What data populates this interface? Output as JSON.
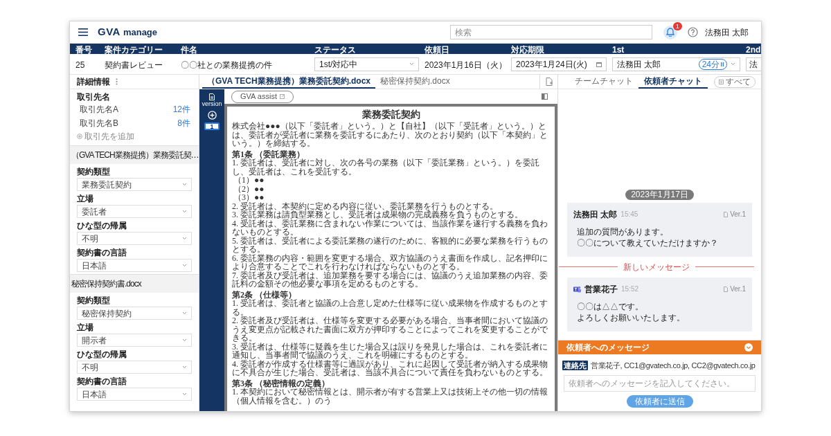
{
  "header": {
    "logo_mark": "GVA",
    "logo_word": "manage",
    "search": {
      "placeholder": "検索"
    },
    "notifications": "1",
    "user": "法務田 太郎"
  },
  "case_table": {
    "columns": [
      "番号",
      "案件カテゴリー",
      "件名",
      "ステータス",
      "依頼日",
      "対応期限",
      "1st",
      "2nd"
    ],
    "row": [
      {
        "kind": "text",
        "value": "25"
      },
      {
        "kind": "text",
        "value": "契約書レビュー"
      },
      {
        "kind": "text",
        "value": "〇〇社との業務提携の件"
      },
      {
        "kind": "select",
        "value": "1st/対応中"
      },
      {
        "kind": "text",
        "value": "2023年1月16日（火）"
      },
      {
        "kind": "date",
        "value": "2023年1月24日(火)"
      },
      {
        "kind": "assignee",
        "value": "法務田 太郎",
        "timer": "24分"
      },
      {
        "kind": "select",
        "value": "法"
      }
    ]
  },
  "details": {
    "title": "詳細情報",
    "partners_label": "取引先名",
    "partners": [
      {
        "name": "取引先名A",
        "count": "12件"
      },
      {
        "name": "取引先名B",
        "count": "8件"
      }
    ],
    "add_partner": "取引先を追加",
    "documents": [
      {
        "title": "（GVA TECH業務提携）業務委託契…",
        "fields": [
          {
            "label": "契約類型",
            "value": "業務委託契約"
          },
          {
            "label": "立場",
            "value": "委託者"
          },
          {
            "label": "ひな型の帰属",
            "value": "不明"
          },
          {
            "label": "契約書の言語",
            "value": "日本語"
          }
        ]
      },
      {
        "title": "秘密保持契約書.docx",
        "fields": [
          {
            "label": "契約類型",
            "value": "秘密保持契約"
          },
          {
            "label": "立場",
            "value": "開示者"
          },
          {
            "label": "ひな型の帰属",
            "value": "不明"
          },
          {
            "label": "契約書の言語",
            "value": "日本語"
          }
        ]
      }
    ]
  },
  "document_tabs": [
    {
      "label": "（GVA TECH業務提携）業務委託契約.docx",
      "selected": true
    },
    {
      "label": "秘密保持契約.docx",
      "selected": false
    }
  ],
  "version_rail": {
    "label": "version",
    "current": "1"
  },
  "assist_button": "GVA assist",
  "document": {
    "title": "業務委託契約",
    "blocks": [
      {
        "kind": "paragraph",
        "text": "株式会社●●●（以下「委託者」という。）と【自社】（以下「受託者」という。）とは、委託者が受託者に業務を委託するにあたり、次のとおり契約（以下「本契約」という。）を締結する。"
      },
      {
        "kind": "heading",
        "text": "第1条 （委託業務）"
      },
      {
        "kind": "paragraph",
        "text": "1. 委託者は、受託者に対し、次の各号の業務（以下「委託業務」という。）を委託し、受託者は、これを受託する。"
      },
      {
        "kind": "item",
        "text": "（1）●●"
      },
      {
        "kind": "item",
        "text": "（2）●●"
      },
      {
        "kind": "item",
        "text": "（3）●●"
      },
      {
        "kind": "paragraph",
        "text": "2. 受託者は、本契約に定める内容に従い、委託業務を行うものとする。"
      },
      {
        "kind": "paragraph",
        "text": "3. 委託業務は請負型業務とし、受託者は成果物の完成義務を負うものとする。"
      },
      {
        "kind": "paragraph",
        "text": "4. 受託者は、委託業務に含まれない作業については、当該作業を遂行する義務を負わないものとする。"
      },
      {
        "kind": "paragraph",
        "text": "5. 委託者は、受託者による委託業務の遂行のために、客観的に必要な業務を行うものとする。"
      },
      {
        "kind": "paragraph",
        "text": "6. 委託業務の内容・範囲を変更する場合、双方協議のうえ書面を作成し、記名押印により合意することでこれを行わなければならないものとする。"
      },
      {
        "kind": "paragraph",
        "text": "7. 委託者及び受託者は、追加業務を要する場合には、協議のうえ追加業務の内容、委託料の金額その他必要な事項を定めるものとする。"
      },
      {
        "kind": "heading",
        "text": "第2条 （仕様等）"
      },
      {
        "kind": "paragraph",
        "text": "1. 受託者は、委託者と協議の上合意し定めた仕様等に従い成果物を作成するものとする。"
      },
      {
        "kind": "paragraph",
        "text": "2. 委託者及び受託者は、仕様等を変更する必要がある場合、当事者間において協議のうえ変更点が記載された書面に双方が押印することによってこれを変更することができる。"
      },
      {
        "kind": "paragraph",
        "text": "3. 受託者は、仕様等に疑義を生じた場合又は誤りを発見した場合は、これを委託者に通知し、当事者間で協議のうえ、これを明確にするものとする。"
      },
      {
        "kind": "paragraph",
        "text": "4. 委託者が作成する仕様書等に過誤があり、これに起因して受託者が納入する成果物に不具合が生じた場合、受託者は、当該不具合について責任を負わないものとする。"
      },
      {
        "kind": "heading",
        "text": "第3条 （秘密情報の定義）"
      },
      {
        "kind": "paragraph",
        "text": "1. 本契約において秘密情報とは、開示者が有する営業上又は技術上その他一切の情報（個人情報を含む。）のう"
      }
    ]
  },
  "chat": {
    "tabs": [
      {
        "label": "チームチャット",
        "selected": false
      },
      {
        "label": "依頼者チャット",
        "selected": true
      }
    ],
    "filter": "すべて",
    "date": "2023年1月17日",
    "entries": [
      {
        "kind": "message",
        "sender": "法務田 太郎",
        "time": "15:45",
        "version": "Ver.1",
        "teams": false,
        "lines": [
          "追加の質問があります。",
          "〇〇について教えていただけますか？"
        ]
      },
      {
        "kind": "divider",
        "text": "新しいメッセージ"
      },
      {
        "kind": "message",
        "sender": "営業花子",
        "time": "15:52",
        "version": "Ver.1",
        "teams": true,
        "lines": [
          "〇〇は△△です。",
          "よろしくお願いいたします。"
        ]
      }
    ]
  },
  "composer": {
    "title": "依頼者へのメッセージ",
    "recipient_tag": "連絡先",
    "recipients": "営業花子, CC1@gvatech.co.jp, CC2@gvatech.co.jp",
    "placeholder": "依頼者へのメッセージを記入してください。",
    "send": "依頼者に送信"
  }
}
